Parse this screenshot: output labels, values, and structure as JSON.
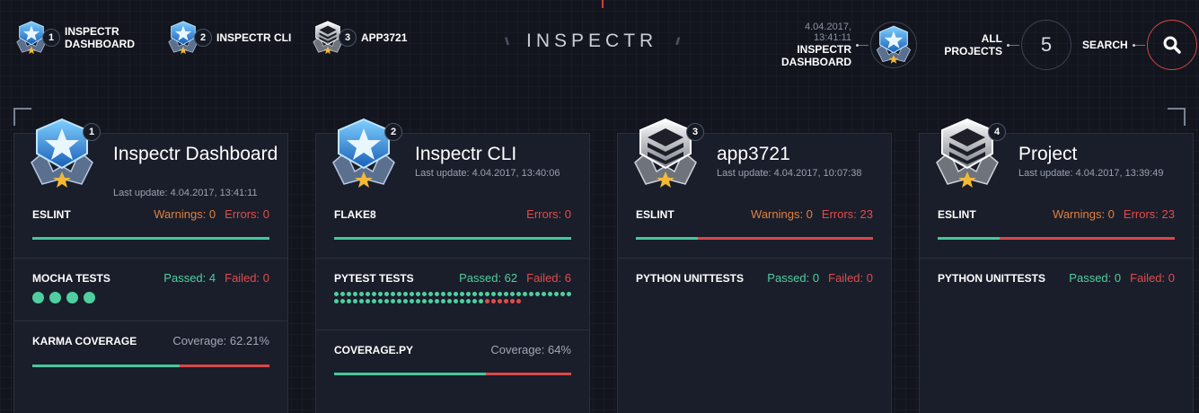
{
  "app_title": "INSPECTR",
  "recent": [
    {
      "num": "1",
      "label": "INSPECTR DASHBOARD",
      "badge": "star-badge-icon"
    },
    {
      "num": "2",
      "label": "INSPECTR CLI",
      "badge": "star-badge-icon"
    },
    {
      "num": "3",
      "label": "APP3721",
      "badge": "stack-badge-icon"
    }
  ],
  "current": {
    "date": "4.04.2017, 13:41:11",
    "name": "INSPECTR DASHBOARD"
  },
  "all_projects": {
    "label": "ALL PROJECTS",
    "count": "5"
  },
  "search": {
    "label": "SEARCH"
  },
  "projects": [
    {
      "num": "1",
      "title": "Inspectr Dashboard",
      "last_update": "Last update: 4.04.2017, 13:41:11",
      "sections": [
        {
          "name": "ESLINT",
          "warnings": "Warnings: 0",
          "errors": "Errors: 0",
          "pass_ratio": 1.0
        },
        {
          "name": "MOCHA TESTS",
          "passed": "Passed: 4",
          "failed": "Failed: 0",
          "passed_count": 4,
          "failed_count": 0
        },
        {
          "name": "KARMA COVERAGE",
          "coverage": "Coverage: 62.21%",
          "coverage_ratio": 0.6221
        }
      ]
    },
    {
      "num": "2",
      "title": "Inspectr CLI",
      "last_update": "Last update: 4.04.2017, 13:40:06",
      "sections": [
        {
          "name": "FLAKE8",
          "errors": "Errors: 0",
          "pass_ratio": 1.0
        },
        {
          "name": "PYTEST TESTS",
          "passed": "Passed: 62",
          "failed": "Failed: 6",
          "passed_count": 62,
          "failed_count": 6
        },
        {
          "name": "COVERAGE.PY",
          "coverage": "Coverage: 64%",
          "coverage_ratio": 0.64
        }
      ]
    },
    {
      "num": "3",
      "title": "app3721",
      "last_update": "Last update: 4.04.2017, 10:07:38",
      "sections": [
        {
          "name": "ESLINT",
          "warnings": "Warnings: 0",
          "errors": "Errors: 23",
          "pass_ratio": 0.26
        },
        {
          "name": "PYTHON UNITTESTS",
          "passed": "Passed: 0",
          "failed": "Failed: 0"
        }
      ]
    },
    {
      "num": "4",
      "title": "Project",
      "last_update": "Last update: 4.04.2017, 13:39:49",
      "sections": [
        {
          "name": "ESLINT",
          "warnings": "Warnings: 0",
          "errors": "Errors: 23",
          "pass_ratio": 0.26
        },
        {
          "name": "PYTHON UNITTESTS",
          "passed": "Passed: 0",
          "failed": "Failed: 0"
        }
      ]
    }
  ]
}
